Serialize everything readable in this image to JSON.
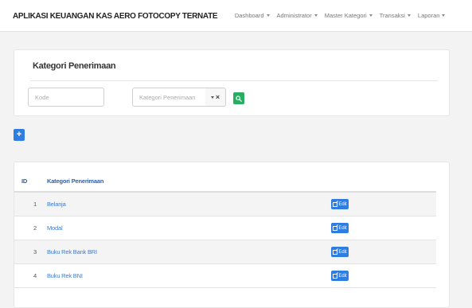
{
  "navbar": {
    "brand": "APLIKASI KEUANGAN KAS AERO FOTOCOPY TERNATE",
    "menu": [
      {
        "label": "Dashboard"
      },
      {
        "label": "Administrator"
      },
      {
        "label": "Master Kategori"
      },
      {
        "label": "Transaksi"
      },
      {
        "label": "Laporan"
      }
    ]
  },
  "filter_panel": {
    "title": "Kategori Penerimaan",
    "kode_placeholder": "Kode",
    "kategori_placeholder": "Kategori Penerimaan",
    "clear_symbol": "×"
  },
  "add_button": {
    "symbol": "+"
  },
  "table": {
    "headers": {
      "id": "ID",
      "kategori": "Kategori Penerimaan"
    },
    "edit_label": "Edit",
    "rows": [
      {
        "id": "1",
        "name": "Belanja"
      },
      {
        "id": "2",
        "name": "Modal"
      },
      {
        "id": "3",
        "name": "Buku Rek Bank BRI"
      },
      {
        "id": "4",
        "name": "Buku Rek BNI"
      }
    ]
  },
  "colors": {
    "primary": "#2f7de1",
    "success": "#27ae60",
    "link": "#3f7bd0",
    "header_text": "#2f5fa8"
  }
}
